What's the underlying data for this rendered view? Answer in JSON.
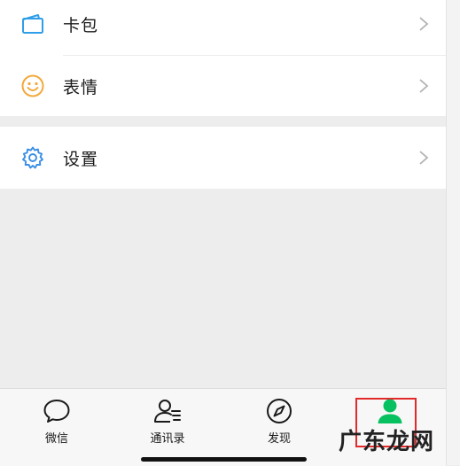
{
  "menu": {
    "items": [
      {
        "label": "卡包",
        "icon": "card-wallet-icon"
      },
      {
        "label": "表情",
        "icon": "smiley-face-icon"
      },
      {
        "label": "设置",
        "icon": "gear-icon"
      }
    ]
  },
  "tabbar": {
    "tabs": [
      {
        "label": "微信",
        "icon": "chat-bubble-icon"
      },
      {
        "label": "通讯录",
        "icon": "contacts-icon"
      },
      {
        "label": "发现",
        "icon": "compass-icon"
      },
      {
        "label": "",
        "icon": "person-icon",
        "active": true
      }
    ]
  },
  "watermark": "广东龙网",
  "colors": {
    "accent_green": "#07c160",
    "wallet_blue": "#2f9ee8",
    "emoji_yellow": "#f2a93b",
    "settings_blue": "#3a8ee6",
    "highlight_red": "#e32a2a"
  }
}
